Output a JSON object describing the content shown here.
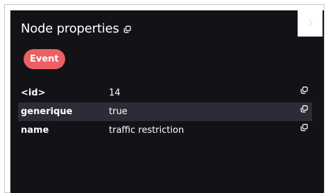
{
  "panel": {
    "title": "Node properties",
    "title_icon": "copy-icon",
    "close_icon": "chevron-right-icon",
    "badge": "Event",
    "badge_color": "#ec5f63",
    "background_color": "#131216",
    "highlight_color": "#2c2c36"
  },
  "properties": [
    {
      "key": "<id>",
      "value": "14",
      "icon": "copy-icon"
    },
    {
      "key": "generique",
      "value": "true",
      "icon": "copy-icon",
      "highlighted": true
    },
    {
      "key": "name",
      "value": "traffic restriction",
      "icon": "copy-icon"
    }
  ]
}
